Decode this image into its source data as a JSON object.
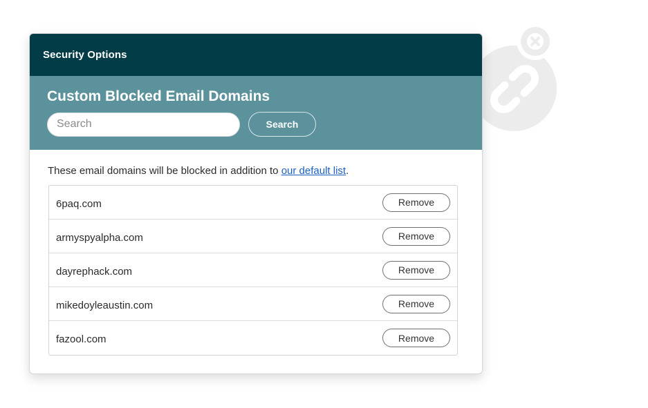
{
  "header": {
    "title": "Security Options"
  },
  "band": {
    "heading": "Custom Blocked Email Domains",
    "search_placeholder": "Search",
    "search_value": "",
    "search_button_label": "Search"
  },
  "content": {
    "intro_text": "These email domains will be blocked in addition to ",
    "intro_link": "our default list",
    "intro_suffix": "."
  },
  "domains": [
    {
      "name": "6paq.com",
      "action": "Remove"
    },
    {
      "name": "armyspyalpha.com",
      "action": "Remove"
    },
    {
      "name": "dayrephack.com",
      "action": "Remove"
    },
    {
      "name": "mikedoyleaustin.com",
      "action": "Remove"
    },
    {
      "name": "fazool.com",
      "action": "Remove"
    }
  ],
  "colors": {
    "header_bg": "#023c46",
    "band_bg": "#5b929c",
    "link": "#1c5fc4"
  },
  "icons": {
    "decoration": "broken-link-badge-icon"
  }
}
